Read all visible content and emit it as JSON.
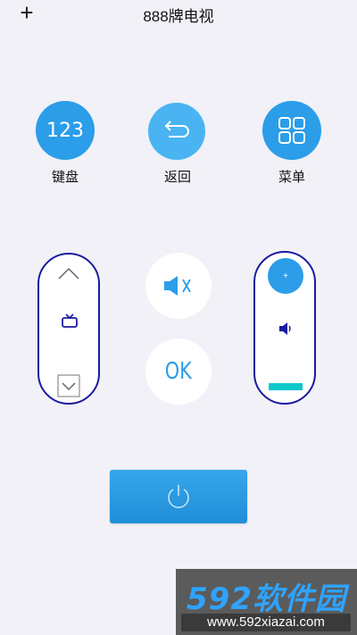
{
  "header": {
    "add_symbol": "+",
    "title": "888牌电视"
  },
  "shortcuts": [
    {
      "icon_text": "123",
      "label": "键盘",
      "icon": "number-keypad-icon"
    },
    {
      "label": "返回",
      "icon": "back-arrow-icon"
    },
    {
      "label": "菜单",
      "icon": "menu-grid-icon"
    }
  ],
  "center": {
    "mute_icon": "mute-speaker-icon",
    "ok_label": "OK"
  },
  "channel": {
    "up_icon": "chevron-up-icon",
    "tv_icon": "tv-icon",
    "down_icon": "chevron-down-icon"
  },
  "volume": {
    "plus_symbol": "+",
    "speaker_icon": "speaker-icon",
    "minus_bar_color": "#10c8cc"
  },
  "power": {
    "icon": "power-icon"
  },
  "watermark": {
    "brand": "592软件园",
    "url": "www.592xiazai.com"
  },
  "colors": {
    "primary": "#2b9de9",
    "outline": "#1a1aa0",
    "background": "#f1f1f7"
  }
}
